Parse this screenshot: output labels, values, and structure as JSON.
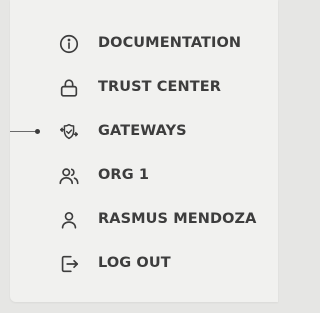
{
  "menu": {
    "items": [
      {
        "label": "DOCUMENTATION",
        "icon": "info-circle-icon"
      },
      {
        "label": "TRUST CENTER",
        "icon": "lock-icon"
      },
      {
        "label": "GATEWAYS",
        "icon": "gateway-shield-icon"
      },
      {
        "label": "ORG 1",
        "icon": "users-icon"
      },
      {
        "label": "RASMUS MENDOZA",
        "icon": "user-icon"
      },
      {
        "label": "LOG OUT",
        "icon": "logout-icon"
      }
    ]
  },
  "colors": {
    "text": "#3d3d3d",
    "panel_background": "#f1f1ef",
    "page_background": "#e6e6e4"
  }
}
